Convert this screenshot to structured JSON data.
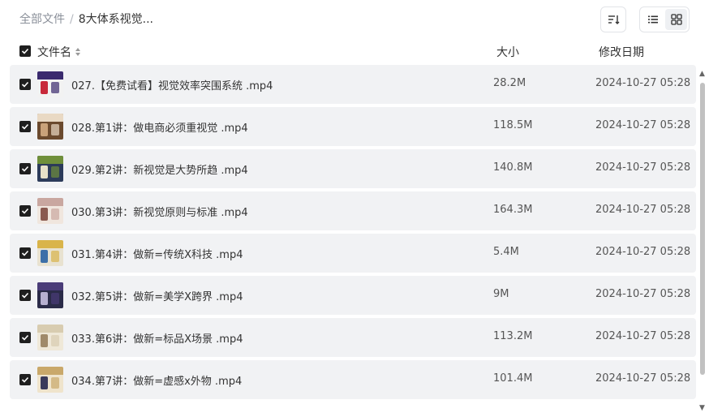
{
  "breadcrumb": {
    "root": "全部文件",
    "separator": "/",
    "current": "8大体系视觉..."
  },
  "table_header": {
    "name": "文件名",
    "size": "大小",
    "modified": "修改日期"
  },
  "files": [
    {
      "name": "027.【免费试看】视觉效率突围系统 .mp4",
      "size": "28.2M",
      "date": "2024-10-27 05:28",
      "thumb": [
        "#3a2a6e",
        "#c8293a",
        "#f2f2f2"
      ]
    },
    {
      "name": "028.第1讲：做电商必须重视觉 .mp4",
      "size": "118.5M",
      "date": "2024-10-27 05:28",
      "thumb": [
        "#e9d9c4",
        "#c9a27a",
        "#6b4a2e"
      ]
    },
    {
      "name": "029.第2讲：新视觉是大势所趋 .mp4",
      "size": "140.8M",
      "date": "2024-10-27 05:28",
      "thumb": [
        "#6f8f3a",
        "#e6e0c8",
        "#2c3b5a"
      ]
    },
    {
      "name": "030.第3讲：新视觉原则与标准 .mp4",
      "size": "164.3M",
      "date": "2024-10-27 05:28",
      "thumb": [
        "#c9a7a0",
        "#8a5a50",
        "#f0e6de"
      ]
    },
    {
      "name": "031.第4讲：做新=传统X科技 .mp4",
      "size": "5.4M",
      "date": "2024-10-27 05:28",
      "thumb": [
        "#d9b44a",
        "#3c6fa8",
        "#e8e2d0"
      ]
    },
    {
      "name": "032.第5讲：做新=美学X跨界 .mp4",
      "size": "9M",
      "date": "2024-10-27 05:28",
      "thumb": [
        "#4a3c78",
        "#b7b0d0",
        "#2b2b48"
      ]
    },
    {
      "name": "033.第6讲：做新=标品X场景 .mp4",
      "size": "113.2M",
      "date": "2024-10-27 05:28",
      "thumb": [
        "#d8ccb0",
        "#a08a6a",
        "#efe8d8"
      ]
    },
    {
      "name": "034.第7讲：做新=虚感x外物 .mp4",
      "size": "101.4M",
      "date": "2024-10-27 05:28",
      "thumb": [
        "#c9a86a",
        "#3a3a5a",
        "#efe4cc"
      ]
    }
  ],
  "colors": {
    "row_bg": "#f1f2f4",
    "checkbox": "#1f1f1f",
    "accent_text": "#333333"
  },
  "icons": {
    "sort": "sort-icon",
    "list_view": "list-view-icon",
    "grid_view": "grid-view-icon"
  }
}
